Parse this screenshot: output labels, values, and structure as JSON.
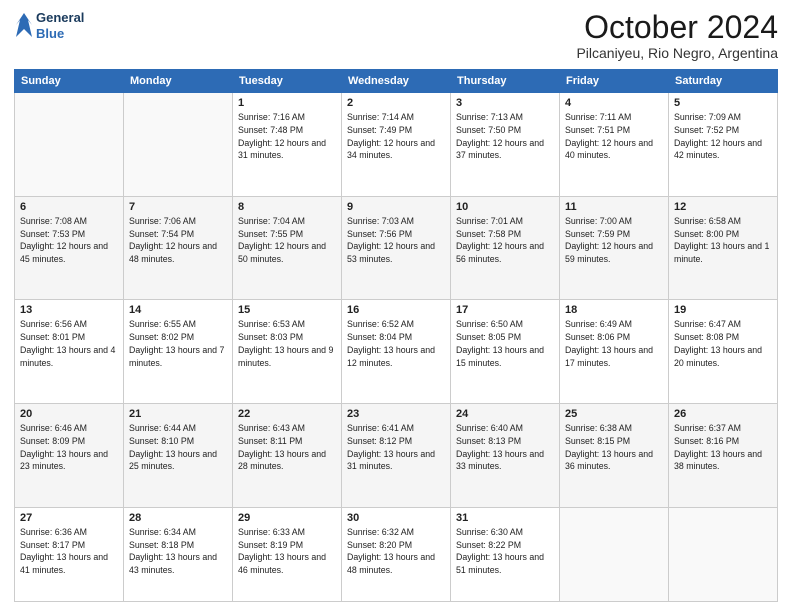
{
  "header": {
    "logo_line1": "General",
    "logo_line2": "Blue",
    "month": "October 2024",
    "location": "Pilcaniyeu, Rio Negro, Argentina"
  },
  "weekdays": [
    "Sunday",
    "Monday",
    "Tuesday",
    "Wednesday",
    "Thursday",
    "Friday",
    "Saturday"
  ],
  "weeks": [
    [
      {
        "day": "",
        "sunrise": "",
        "sunset": "",
        "daylight": ""
      },
      {
        "day": "",
        "sunrise": "",
        "sunset": "",
        "daylight": ""
      },
      {
        "day": "1",
        "sunrise": "Sunrise: 7:16 AM",
        "sunset": "Sunset: 7:48 PM",
        "daylight": "Daylight: 12 hours and 31 minutes."
      },
      {
        "day": "2",
        "sunrise": "Sunrise: 7:14 AM",
        "sunset": "Sunset: 7:49 PM",
        "daylight": "Daylight: 12 hours and 34 minutes."
      },
      {
        "day": "3",
        "sunrise": "Sunrise: 7:13 AM",
        "sunset": "Sunset: 7:50 PM",
        "daylight": "Daylight: 12 hours and 37 minutes."
      },
      {
        "day": "4",
        "sunrise": "Sunrise: 7:11 AM",
        "sunset": "Sunset: 7:51 PM",
        "daylight": "Daylight: 12 hours and 40 minutes."
      },
      {
        "day": "5",
        "sunrise": "Sunrise: 7:09 AM",
        "sunset": "Sunset: 7:52 PM",
        "daylight": "Daylight: 12 hours and 42 minutes."
      }
    ],
    [
      {
        "day": "6",
        "sunrise": "Sunrise: 7:08 AM",
        "sunset": "Sunset: 7:53 PM",
        "daylight": "Daylight: 12 hours and 45 minutes."
      },
      {
        "day": "7",
        "sunrise": "Sunrise: 7:06 AM",
        "sunset": "Sunset: 7:54 PM",
        "daylight": "Daylight: 12 hours and 48 minutes."
      },
      {
        "day": "8",
        "sunrise": "Sunrise: 7:04 AM",
        "sunset": "Sunset: 7:55 PM",
        "daylight": "Daylight: 12 hours and 50 minutes."
      },
      {
        "day": "9",
        "sunrise": "Sunrise: 7:03 AM",
        "sunset": "Sunset: 7:56 PM",
        "daylight": "Daylight: 12 hours and 53 minutes."
      },
      {
        "day": "10",
        "sunrise": "Sunrise: 7:01 AM",
        "sunset": "Sunset: 7:58 PM",
        "daylight": "Daylight: 12 hours and 56 minutes."
      },
      {
        "day": "11",
        "sunrise": "Sunrise: 7:00 AM",
        "sunset": "Sunset: 7:59 PM",
        "daylight": "Daylight: 12 hours and 59 minutes."
      },
      {
        "day": "12",
        "sunrise": "Sunrise: 6:58 AM",
        "sunset": "Sunset: 8:00 PM",
        "daylight": "Daylight: 13 hours and 1 minute."
      }
    ],
    [
      {
        "day": "13",
        "sunrise": "Sunrise: 6:56 AM",
        "sunset": "Sunset: 8:01 PM",
        "daylight": "Daylight: 13 hours and 4 minutes."
      },
      {
        "day": "14",
        "sunrise": "Sunrise: 6:55 AM",
        "sunset": "Sunset: 8:02 PM",
        "daylight": "Daylight: 13 hours and 7 minutes."
      },
      {
        "day": "15",
        "sunrise": "Sunrise: 6:53 AM",
        "sunset": "Sunset: 8:03 PM",
        "daylight": "Daylight: 13 hours and 9 minutes."
      },
      {
        "day": "16",
        "sunrise": "Sunrise: 6:52 AM",
        "sunset": "Sunset: 8:04 PM",
        "daylight": "Daylight: 13 hours and 12 minutes."
      },
      {
        "day": "17",
        "sunrise": "Sunrise: 6:50 AM",
        "sunset": "Sunset: 8:05 PM",
        "daylight": "Daylight: 13 hours and 15 minutes."
      },
      {
        "day": "18",
        "sunrise": "Sunrise: 6:49 AM",
        "sunset": "Sunset: 8:06 PM",
        "daylight": "Daylight: 13 hours and 17 minutes."
      },
      {
        "day": "19",
        "sunrise": "Sunrise: 6:47 AM",
        "sunset": "Sunset: 8:08 PM",
        "daylight": "Daylight: 13 hours and 20 minutes."
      }
    ],
    [
      {
        "day": "20",
        "sunrise": "Sunrise: 6:46 AM",
        "sunset": "Sunset: 8:09 PM",
        "daylight": "Daylight: 13 hours and 23 minutes."
      },
      {
        "day": "21",
        "sunrise": "Sunrise: 6:44 AM",
        "sunset": "Sunset: 8:10 PM",
        "daylight": "Daylight: 13 hours and 25 minutes."
      },
      {
        "day": "22",
        "sunrise": "Sunrise: 6:43 AM",
        "sunset": "Sunset: 8:11 PM",
        "daylight": "Daylight: 13 hours and 28 minutes."
      },
      {
        "day": "23",
        "sunrise": "Sunrise: 6:41 AM",
        "sunset": "Sunset: 8:12 PM",
        "daylight": "Daylight: 13 hours and 31 minutes."
      },
      {
        "day": "24",
        "sunrise": "Sunrise: 6:40 AM",
        "sunset": "Sunset: 8:13 PM",
        "daylight": "Daylight: 13 hours and 33 minutes."
      },
      {
        "day": "25",
        "sunrise": "Sunrise: 6:38 AM",
        "sunset": "Sunset: 8:15 PM",
        "daylight": "Daylight: 13 hours and 36 minutes."
      },
      {
        "day": "26",
        "sunrise": "Sunrise: 6:37 AM",
        "sunset": "Sunset: 8:16 PM",
        "daylight": "Daylight: 13 hours and 38 minutes."
      }
    ],
    [
      {
        "day": "27",
        "sunrise": "Sunrise: 6:36 AM",
        "sunset": "Sunset: 8:17 PM",
        "daylight": "Daylight: 13 hours and 41 minutes."
      },
      {
        "day": "28",
        "sunrise": "Sunrise: 6:34 AM",
        "sunset": "Sunset: 8:18 PM",
        "daylight": "Daylight: 13 hours and 43 minutes."
      },
      {
        "day": "29",
        "sunrise": "Sunrise: 6:33 AM",
        "sunset": "Sunset: 8:19 PM",
        "daylight": "Daylight: 13 hours and 46 minutes."
      },
      {
        "day": "30",
        "sunrise": "Sunrise: 6:32 AM",
        "sunset": "Sunset: 8:20 PM",
        "daylight": "Daylight: 13 hours and 48 minutes."
      },
      {
        "day": "31",
        "sunrise": "Sunrise: 6:30 AM",
        "sunset": "Sunset: 8:22 PM",
        "daylight": "Daylight: 13 hours and 51 minutes."
      },
      {
        "day": "",
        "sunrise": "",
        "sunset": "",
        "daylight": ""
      },
      {
        "day": "",
        "sunrise": "",
        "sunset": "",
        "daylight": ""
      }
    ]
  ]
}
